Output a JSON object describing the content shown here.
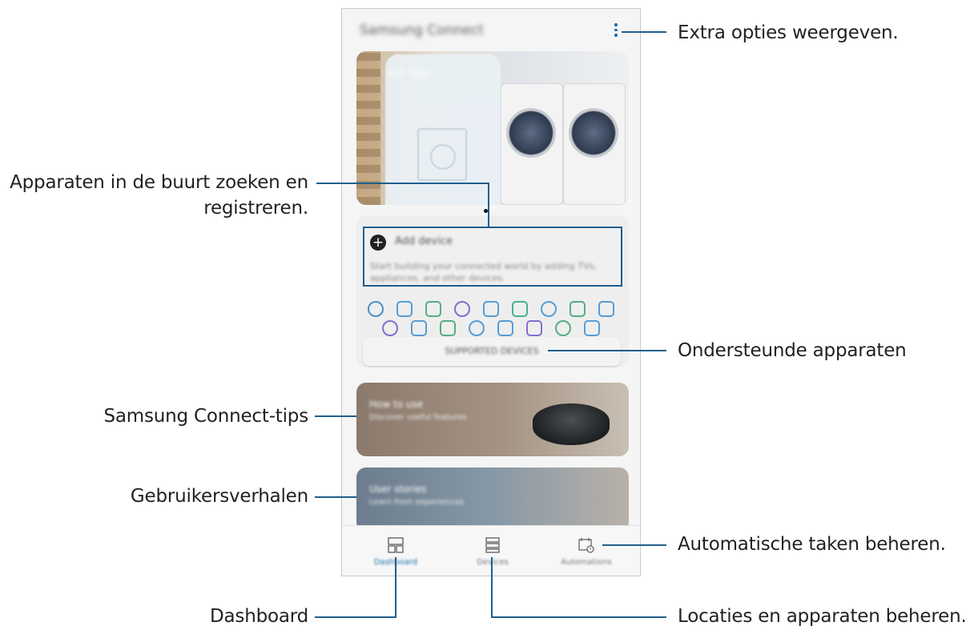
{
  "callouts": {
    "menu": "Extra opties weergeven.",
    "add_device_line1": "Apparaten in de buurt zoeken en",
    "add_device_line2": "registreren.",
    "supported": "Ondersteunde apparaten",
    "tips": "Samsung Connect-tips",
    "stories": "Gebruikersverhalen",
    "automations": "Automatische taken beheren.",
    "dashboard": "Dashboard",
    "locations": "Locaties en apparaten beheren."
  },
  "app": {
    "title": "Samsung Connect",
    "menu_icon": "more-vertical-icon"
  },
  "hero": {
    "text": "IoT tips"
  },
  "add_device": {
    "title": "Add device",
    "description": "Start building your connected world by adding TVs, appliances, and other devices.",
    "icon": "plus-circle-icon"
  },
  "device_icons": [
    "camera",
    "bulb",
    "speaker",
    "remote",
    "monitor",
    "headset",
    "outlet",
    "robot-vacuum",
    "tv",
    "washer",
    "printer",
    "vacuum",
    "camera2",
    "watch",
    "hub",
    "display",
    "tablet"
  ],
  "supported_button": "SUPPORTED DEVICES",
  "tips_card": {
    "title": "How to use",
    "subtitle": "Discover useful features"
  },
  "stories_card": {
    "title": "User stories",
    "subtitle": "Learn from experiences"
  },
  "nav": [
    {
      "label": "Dashboard",
      "icon": "dashboard-icon",
      "active": true
    },
    {
      "label": "Devices",
      "icon": "devices-list-icon",
      "active": false
    },
    {
      "label": "Automations",
      "icon": "calendar-clock-icon",
      "active": false
    }
  ],
  "colors": {
    "callout_line": "#1f5f8e",
    "accent": "#1c6ea8"
  }
}
